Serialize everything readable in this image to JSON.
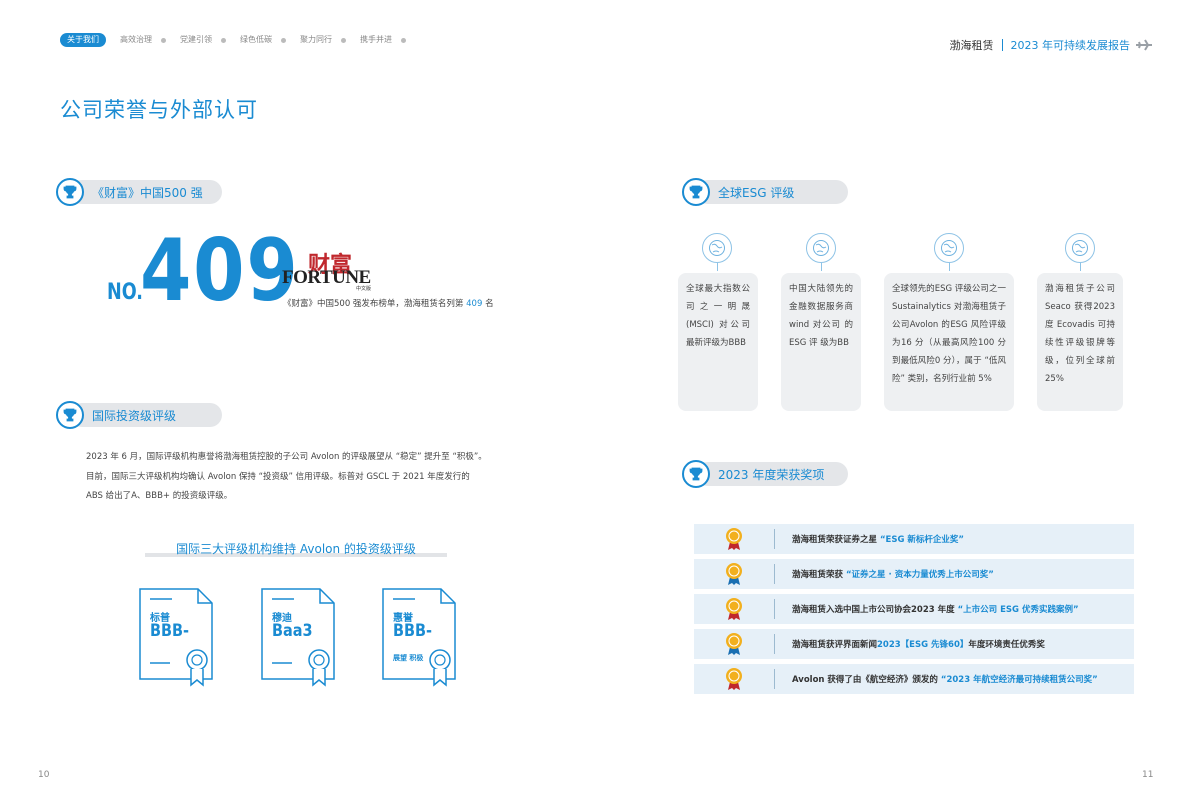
{
  "nav": {
    "active": "关于我们",
    "items": [
      "高效治理",
      "党建引领",
      "绿色低碳",
      "聚力同行",
      "携手并进"
    ]
  },
  "report": {
    "company": "渤海租赁",
    "title": "2023 年可持续发展报告"
  },
  "page_title": "公司荣誉与外部认可",
  "fortune": {
    "header": "《财富》中国500 强",
    "no_label": "NO.",
    "rank": "409",
    "logo_cn": "财富",
    "logo_en": "FORTUNE",
    "logo_sub": "中文版",
    "caption_pre": "《财富》中国500 强发布榜单，渤海租赁名列第",
    "caption_rank": "409",
    "caption_post": "名"
  },
  "intl": {
    "header": "国际投资级评级",
    "para1": "2023 年 6 月，国际评级机构惠誉将渤海租赁控股的子公司 Avolon 的评级展望从 “稳定” 提升至 “积极”。",
    "para2": "目前，国际三大评级机构均确认 Avolon 保持 “投资级” 信用评级。标普对 GSCL 于 2021 年度发行的",
    "para3": "ABS 给出了A、BBB+ 的投资级评级。",
    "subhead": "国际三大评级机构维持 Avolon 的投资级评级",
    "certs": [
      {
        "agency": "标普",
        "rating": "BBB-",
        "note": ""
      },
      {
        "agency": "穆迪",
        "rating": "Baa3",
        "note": ""
      },
      {
        "agency": "惠誉",
        "rating": "BBB-",
        "note": "展望 积极"
      }
    ]
  },
  "esg": {
    "header": "全球ESG 评级",
    "cards": [
      "全球最大指数公司之一明晟(MSCI) 对公司最新评级为BBB",
      "中国大陆领先的金融数据服务商wind 对公司 的 ESG 评 级为BB",
      "全球领先的ESG 评级公司之一Sustainalytics 对渤海租赁子公司Avolon 的ESG 风险评级为16 分（从最高风险100 分到最低风险0 分），属于 “低风险” 类别，名列行业前 5%",
      "渤海租赁子公司Seaco 获得2023 度 Ecovadis 可持续性评级银牌等级，位列全球前25%"
    ]
  },
  "awards": {
    "header": "2023 年度荣获奖项",
    "items": [
      {
        "pre": "渤海租赁荣获证券之星 ",
        "hl": "“ESG 新标杆企业奖”",
        "post": ""
      },
      {
        "pre": "渤海租赁荣获 ",
        "hl": "“证券之星 · 资本力量优秀上市公司奖”",
        "post": ""
      },
      {
        "pre": "渤海租赁入选中国上市公司协会2023 年度 ",
        "hl": "“上市公司 ESG 优秀实践案例”",
        "post": ""
      },
      {
        "pre": "渤海租赁获评界面新闻",
        "hl": "2023【ESG 先锋60】",
        "post": "年度环境责任优秀奖"
      },
      {
        "pre": "Avolon 获得了由《航空经济》颁发的 ",
        "hl": "“2023 年航空经济最可持续租赁公司奖”",
        "post": ""
      }
    ]
  },
  "pages": {
    "left": "10",
    "right": "11"
  },
  "colors": {
    "accent": "#1a8bd2",
    "card_bg": "#eef0f2",
    "award_bg": "#e6f0f8",
    "medal": "#f2b01e"
  }
}
